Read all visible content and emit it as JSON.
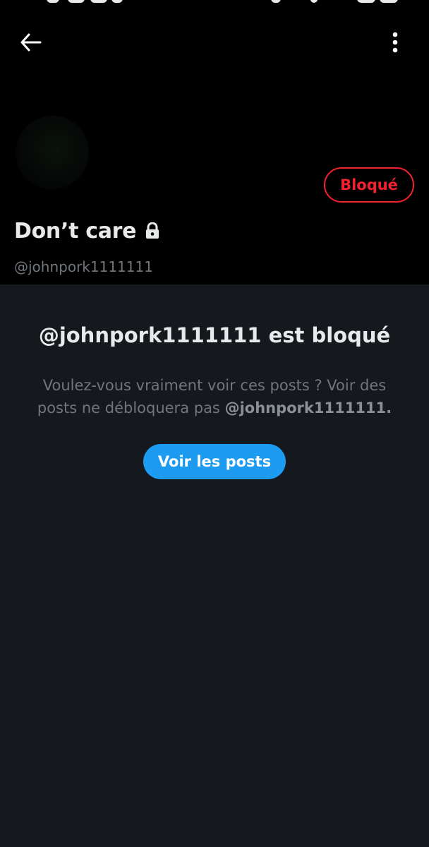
{
  "header": {
    "back_icon": "arrow-left-icon",
    "more_icon": "more-vertical-icon",
    "blocked_label": "Bloqué",
    "blocked_color": "#f4212e"
  },
  "profile": {
    "display_name": "Don’t care",
    "lock_icon": "lock-icon",
    "handle": "@johnpork1111111"
  },
  "blocked_notice": {
    "title": "@johnpork1111111 est bloqué",
    "description_part1": "Voulez-vous vraiment voir ces posts ? Voir des",
    "description_part2": "posts ne débloquera pas ",
    "description_handle": "@johnpork1111111.",
    "view_posts_label": "Voir les posts",
    "button_color": "#1d9bf0"
  }
}
